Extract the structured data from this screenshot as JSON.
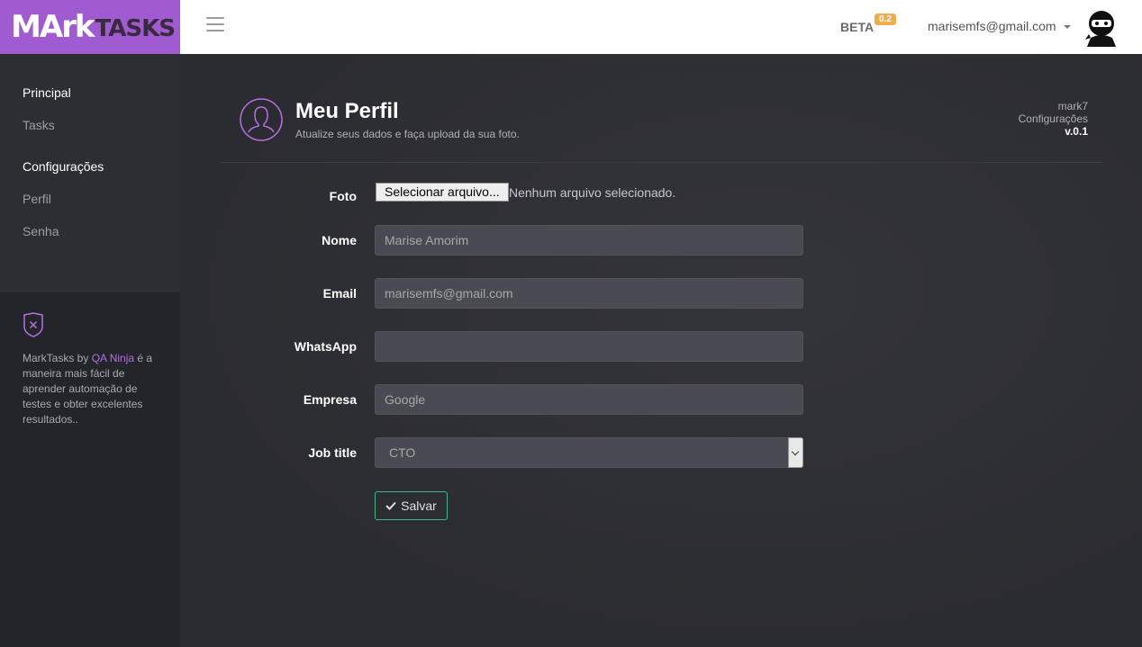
{
  "brand": {
    "logo_main": "MArk",
    "logo_sub": "TASKS"
  },
  "topbar": {
    "beta_label": "BETA",
    "beta_version": "0.2",
    "user_email": "marisemfs@gmail.com"
  },
  "sidebar": {
    "sections": [
      {
        "heading": "Principal",
        "items": [
          "Tasks"
        ]
      },
      {
        "heading": "Configurações",
        "items": [
          "Perfil",
          "Senha"
        ]
      }
    ],
    "promo": {
      "prefix": "MarkTasks by ",
      "link": "QA Ninja",
      "suffix": " é a maneira mais fácil de aprender automação de testes e obter excelentes resultados.."
    }
  },
  "page": {
    "title": "Meu Perfil",
    "subtitle": "Atualize seus dados e faça upload da sua foto.",
    "breadcrumb": {
      "app": "mark7",
      "section": "Configurações",
      "version": "v.0.1"
    }
  },
  "form": {
    "foto_label": "Foto",
    "file_button": "Selecionar arquivo...",
    "file_status": "Nenhum arquivo selecionado.",
    "nome_label": "Nome",
    "nome_value": "Marise Amorim",
    "email_label": "Email",
    "email_value": "marisemfs@gmail.com",
    "whatsapp_label": "WhatsApp",
    "whatsapp_value": "",
    "empresa_label": "Empresa",
    "empresa_value": "Google",
    "job_label": "Job title",
    "job_value": "CTO",
    "save_label": "Salvar"
  },
  "colors": {
    "brand": "#a05bd0",
    "accent": "#b66fe0",
    "success": "#3fb68b",
    "badge": "#f0ad4e"
  }
}
